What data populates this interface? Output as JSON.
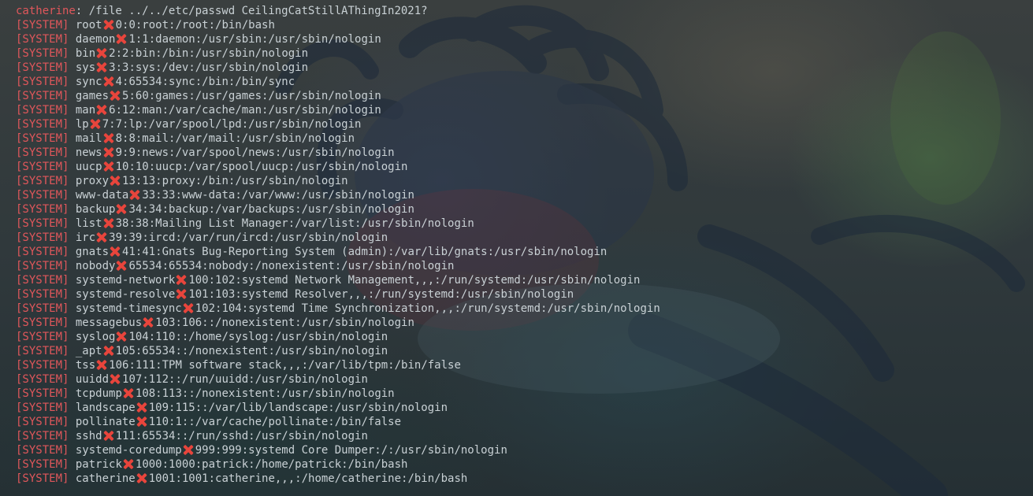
{
  "prompt": {
    "user": "catherine",
    "separator": ": ",
    "command": "/file ../../etc/passwd CeilingCatStillAThingIn2021?"
  },
  "system_tag": "[SYSTEM]",
  "entries": [
    {
      "name": "root",
      "detail": "0:0:root:/root:/bin/bash"
    },
    {
      "name": "daemon",
      "detail": "1:1:daemon:/usr/sbin:/usr/sbin/nologin"
    },
    {
      "name": "bin",
      "detail": "2:2:bin:/bin:/usr/sbin/nologin"
    },
    {
      "name": "sys",
      "detail": "3:3:sys:/dev:/usr/sbin/nologin"
    },
    {
      "name": "sync",
      "detail": "4:65534:sync:/bin:/bin/sync"
    },
    {
      "name": "games",
      "detail": "5:60:games:/usr/games:/usr/sbin/nologin"
    },
    {
      "name": "man",
      "detail": "6:12:man:/var/cache/man:/usr/sbin/nologin"
    },
    {
      "name": "lp",
      "detail": "7:7:lp:/var/spool/lpd:/usr/sbin/nologin"
    },
    {
      "name": "mail",
      "detail": "8:8:mail:/var/mail:/usr/sbin/nologin"
    },
    {
      "name": "news",
      "detail": "9:9:news:/var/spool/news:/usr/sbin/nologin"
    },
    {
      "name": "uucp",
      "detail": "10:10:uucp:/var/spool/uucp:/usr/sbin/nologin"
    },
    {
      "name": "proxy",
      "detail": "13:13:proxy:/bin:/usr/sbin/nologin"
    },
    {
      "name": "www-data",
      "detail": "33:33:www-data:/var/www:/usr/sbin/nologin"
    },
    {
      "name": "backup",
      "detail": "34:34:backup:/var/backups:/usr/sbin/nologin"
    },
    {
      "name": "list",
      "detail": "38:38:Mailing List Manager:/var/list:/usr/sbin/nologin"
    },
    {
      "name": "irc",
      "detail": "39:39:ircd:/var/run/ircd:/usr/sbin/nologin"
    },
    {
      "name": "gnats",
      "detail": "41:41:Gnats Bug-Reporting System (admin):/var/lib/gnats:/usr/sbin/nologin"
    },
    {
      "name": "nobody",
      "detail": "65534:65534:nobody:/nonexistent:/usr/sbin/nologin"
    },
    {
      "name": "systemd-network",
      "detail": "100:102:systemd Network Management,,,:/run/systemd:/usr/sbin/nologin"
    },
    {
      "name": "systemd-resolve",
      "detail": "101:103:systemd Resolver,,,:/run/systemd:/usr/sbin/nologin"
    },
    {
      "name": "systemd-timesync",
      "detail": "102:104:systemd Time Synchronization,,,:/run/systemd:/usr/sbin/nologin"
    },
    {
      "name": "messagebus",
      "detail": "103:106::/nonexistent:/usr/sbin/nologin"
    },
    {
      "name": "syslog",
      "detail": "104:110::/home/syslog:/usr/sbin/nologin"
    },
    {
      "name": "_apt",
      "detail": "105:65534::/nonexistent:/usr/sbin/nologin"
    },
    {
      "name": "tss",
      "detail": "106:111:TPM software stack,,,:/var/lib/tpm:/bin/false"
    },
    {
      "name": "uuidd",
      "detail": "107:112::/run/uuidd:/usr/sbin/nologin"
    },
    {
      "name": "tcpdump",
      "detail": "108:113::/nonexistent:/usr/sbin/nologin"
    },
    {
      "name": "landscape",
      "detail": "109:115::/var/lib/landscape:/usr/sbin/nologin"
    },
    {
      "name": "pollinate",
      "detail": "110:1::/var/cache/pollinate:/bin/false"
    },
    {
      "name": "sshd",
      "detail": "111:65534::/run/sshd:/usr/sbin/nologin"
    },
    {
      "name": "systemd-coredump",
      "detail": "999:999:systemd Core Dumper:/:/usr/sbin/nologin"
    },
    {
      "name": "patrick",
      "detail": "1000:1000:patrick:/home/patrick:/bin/bash"
    },
    {
      "name": "catherine",
      "detail": "1001:1001:catherine,,,:/home/catherine:/bin/bash"
    }
  ],
  "separator_icon": "cross-mark-icon",
  "colors": {
    "tag": "#e0575b",
    "text": "#c9d1d5",
    "cross": "#e8453c"
  }
}
